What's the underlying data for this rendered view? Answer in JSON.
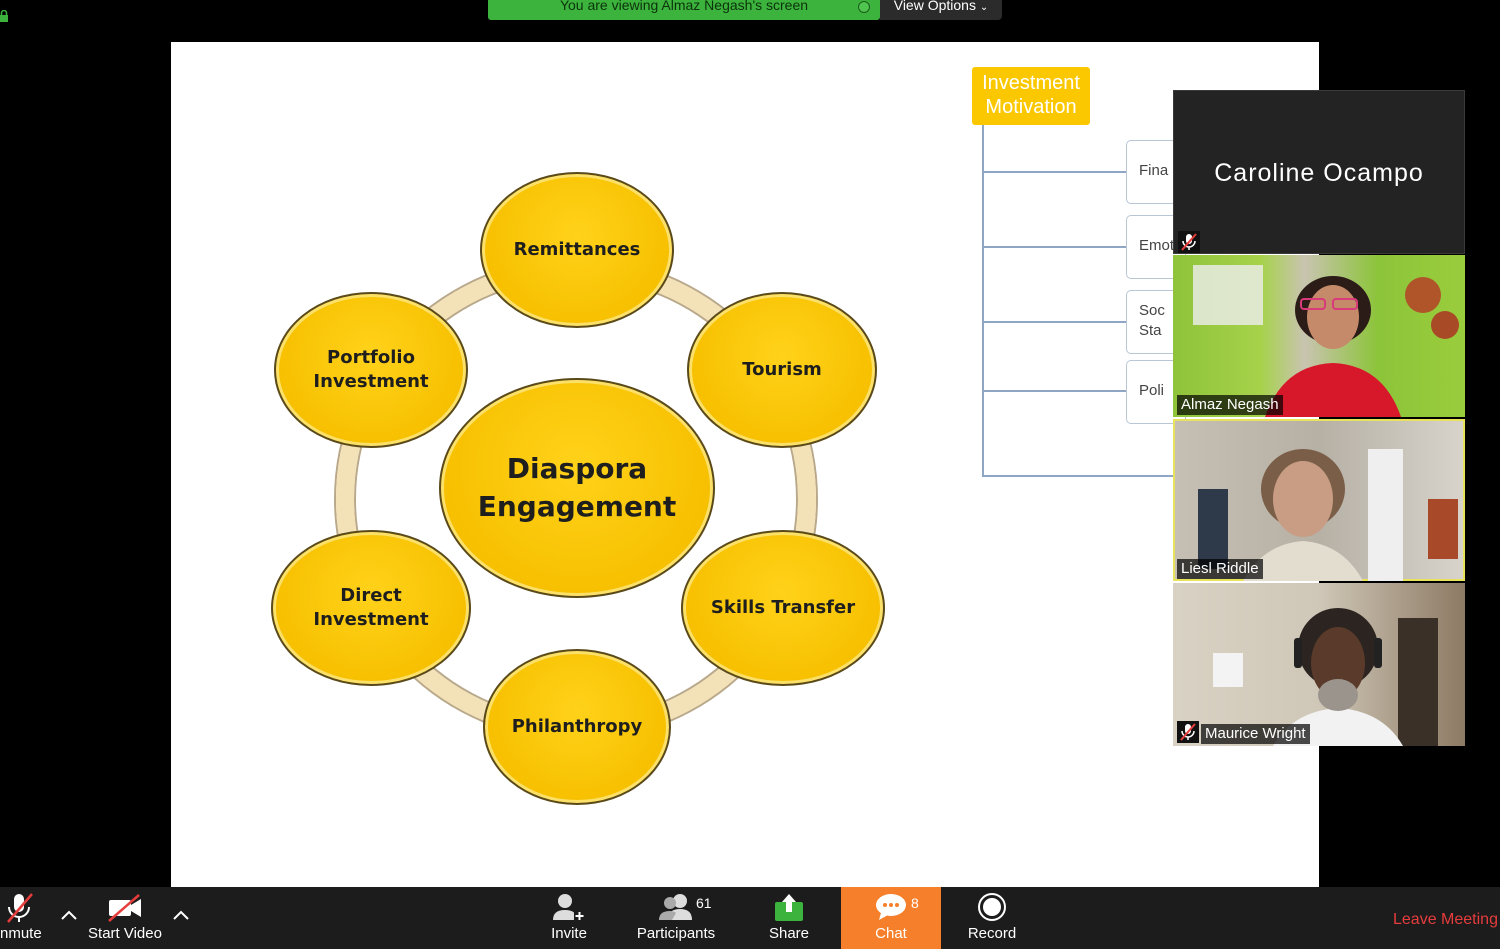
{
  "banner": {
    "sharing_text": "You are viewing Almaz Negash's screen",
    "view_options_label": "View Options"
  },
  "slide": {
    "center": "Diaspora\nEngagement",
    "nodes": {
      "remittances": "Remittances",
      "tourism": "Tourism",
      "skills": "Skills Transfer",
      "philanthropy": "Philanthropy",
      "direct": "Direct\nInvestment",
      "portfolio": "Portfolio\nInvestment"
    },
    "tree": {
      "root": "Investment\nMotivation",
      "items": [
        "Fina",
        "Emot",
        "Soc\nSta",
        "Poli"
      ]
    }
  },
  "video": {
    "participants": [
      {
        "name": "Caroline Ocampo",
        "muted": true
      },
      {
        "name": "Almaz Negash",
        "muted": false
      },
      {
        "name": "Liesl Riddle",
        "muted": false,
        "active_speaker": true
      },
      {
        "name": "Maurice Wright",
        "muted": true
      }
    ]
  },
  "toolbar": {
    "unmute_label": "nmute",
    "start_video_label": "Start Video",
    "invite_label": "Invite",
    "participants_label": "Participants",
    "participants_count": "61",
    "share_label": "Share",
    "chat_label": "Chat",
    "chat_count": "8",
    "record_label": "Record",
    "leave_label": "Leave Meeting",
    "colors": {
      "share_green": "#3cb33c",
      "chat_orange": "#f57f2a",
      "leave_red": "#e63c3c"
    }
  }
}
